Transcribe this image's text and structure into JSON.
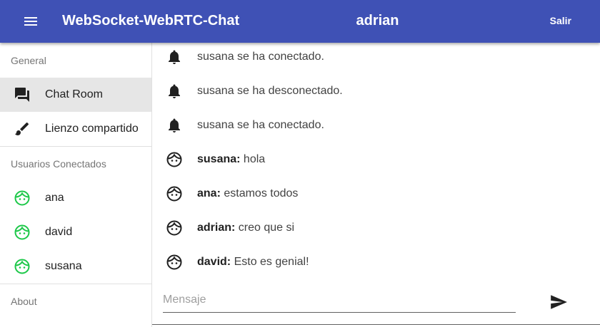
{
  "header": {
    "menu_icon": "menu-icon",
    "app_title": "WebSocket-WebRTC-Chat",
    "current_user": "adrian",
    "logout_label": "Salir",
    "background_color": "#3f51b5"
  },
  "sidebar": {
    "general_title": "General",
    "nav_items": [
      {
        "label": "Chat Room",
        "icon": "forum-icon",
        "active": true
      },
      {
        "label": "Lienzo compartido",
        "icon": "brush-icon",
        "active": false
      }
    ],
    "users_title": "Usuarios Conectados",
    "users": [
      {
        "name": "ana",
        "icon": "face-icon"
      },
      {
        "name": "david",
        "icon": "face-icon"
      },
      {
        "name": "susana",
        "icon": "face-icon"
      }
    ],
    "user_icon_color": "#1ec84a",
    "about_title": "About"
  },
  "messages": [
    {
      "type": "notification",
      "icon": "bell-icon",
      "sender": "",
      "text": "susana se ha conectado."
    },
    {
      "type": "notification",
      "icon": "bell-icon",
      "sender": "",
      "text": "susana se ha desconectado."
    },
    {
      "type": "notification",
      "icon": "bell-icon",
      "sender": "",
      "text": "susana se ha conectado."
    },
    {
      "type": "chat",
      "icon": "face-icon",
      "sender": "susana:",
      "text": " hola"
    },
    {
      "type": "chat",
      "icon": "face-icon",
      "sender": "ana:",
      "text": " estamos todos"
    },
    {
      "type": "chat",
      "icon": "face-icon",
      "sender": "adrian:",
      "text": " creo que si"
    },
    {
      "type": "chat",
      "icon": "face-icon",
      "sender": "david:",
      "text": " Esto es genial!"
    }
  ],
  "composer": {
    "placeholder": "Mensaje",
    "value": "",
    "send_icon": "send-icon"
  }
}
